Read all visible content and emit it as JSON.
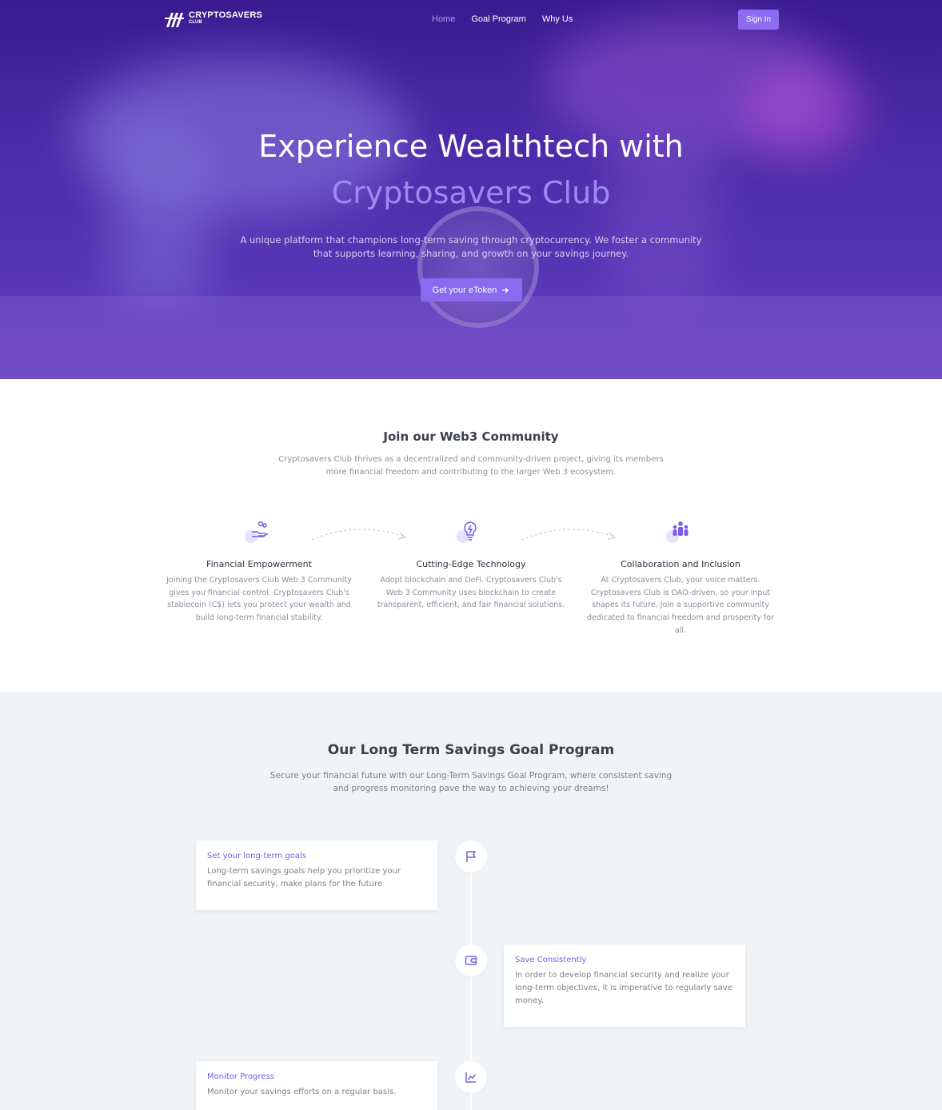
{
  "nav": {
    "logo_line1": "CRYPTOSAVERS",
    "logo_line2": "CLUB",
    "items": [
      "Home",
      "Goal Program",
      "Why Us"
    ],
    "signin": "Sign In"
  },
  "hero": {
    "title_line1": "Experience Wealthtech with",
    "title_line2": "Cryptosavers Club",
    "subtitle": "A unique platform that champions long-term saving through cryptocurrency. We foster a community that supports learning, sharing, and growth on your savings journey.",
    "cta": "Get your eToken"
  },
  "community": {
    "title": "Join our Web3 Community",
    "subtitle": "Cryptosavers Club thrives as a decentralized and community-driven project, giving its members more financial freedom and contributing to the larger Web 3 ecosystem.",
    "features": [
      {
        "title": "Financial Empowerment",
        "text": "Joining the Cryptosavers Club Web 3 Community gives you financial control. Cryptosavers Club's stablecoin (C$) lets you protect your wealth and build long-term financial stability.",
        "icon": "hand-coins-icon"
      },
      {
        "title": "Cutting-Edge Technology",
        "text": "Adopt blockchain and DeFi. Cryptosavers Club's Web 3 Community uses blockchain to create transparent, efficient, and fair financial solutions.",
        "icon": "lightbulb-icon"
      },
      {
        "title": "Collaboration and Inclusion",
        "text": "At Cryptosavers Club, your voice matters. Cryptosavers Club is DAO-driven, so your input shapes its future. Join a supportive community dedicated to financial freedom and prosperity for all.",
        "icon": "people-icon"
      }
    ]
  },
  "goals": {
    "title": "Our Long Term Savings Goal Program",
    "subtitle": "Secure your financial future with our Long-Term Savings Goal Program, where consistent saving and progress monitoring pave the way to achieving your dreams!",
    "steps": [
      {
        "title": "Set your long-term goals",
        "text": "Long-term savings goals help you prioritize your financial security, make plans for the future",
        "icon": "flag-icon"
      },
      {
        "title": "Save Consistently",
        "text": "In order to develop financial security and realize your long-term objectives, it is imperative to regularly save money.",
        "icon": "wallet-icon"
      },
      {
        "title": "Monitor Progress",
        "text": "Monitor your savings efforts on a regular basis.",
        "icon": "chart-line-icon"
      }
    ]
  },
  "colors": {
    "accent": "#8b6cf3",
    "hero_bg": "#4a2aa8",
    "section_bg": "#f1f4f7"
  }
}
